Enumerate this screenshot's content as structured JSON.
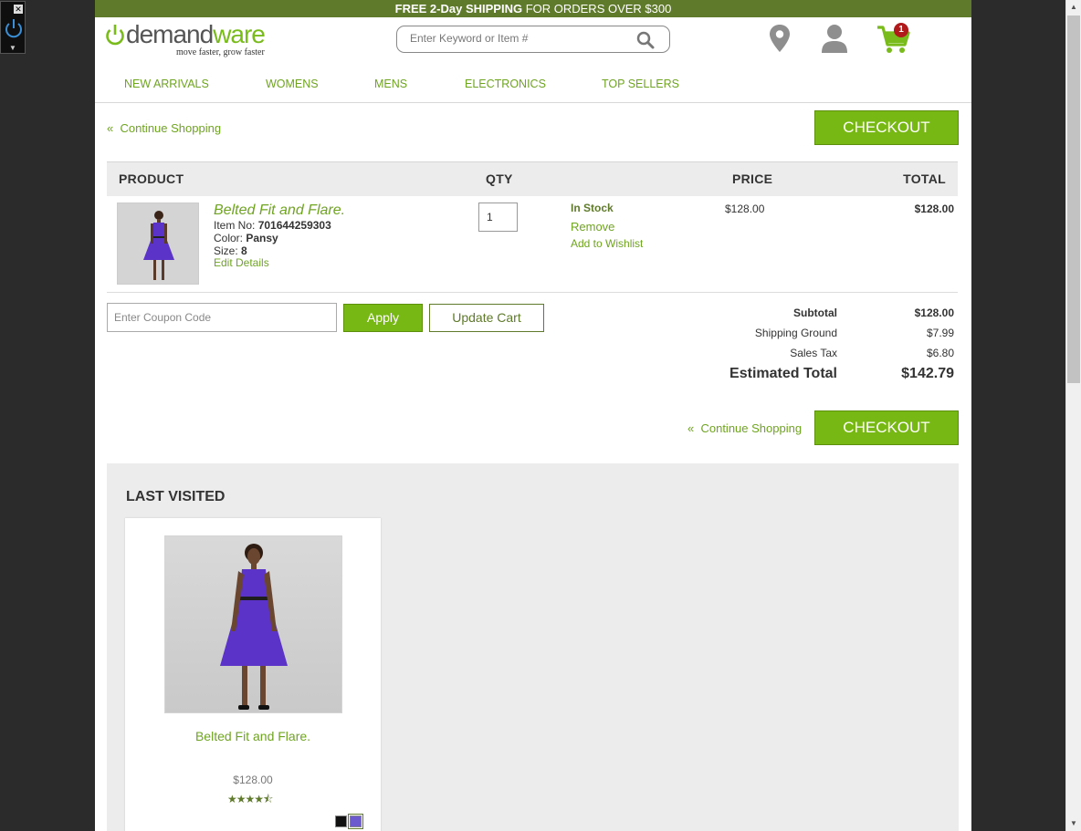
{
  "promo": {
    "bold1": "FREE 2-Day ",
    "bold2": "SHIPPING",
    "rest": " FOR ORDERS OVER $300"
  },
  "brand": {
    "logo_word_start": "demand",
    "logo_word_end": "ware",
    "tagline": "move faster, grow faster",
    "accent": "#78bb1a",
    "dark_green": "#5f7a2b"
  },
  "search": {
    "placeholder": "Enter Keyword or Item #"
  },
  "header_icons": [
    "map-pin-icon",
    "user-icon",
    "cart-icon"
  ],
  "cart": {
    "count": "1"
  },
  "nav": {
    "items": [
      "NEW ARRIVALS",
      "WOMENS",
      "MENS",
      "ELECTRONICS",
      "TOP SELLERS"
    ]
  },
  "actions": {
    "continue_shopping": "Continue Shopping",
    "checkout": "CHECKOUT",
    "apply": "Apply",
    "update_cart": "Update Cart",
    "coupon_placeholder": "Enter Coupon Code"
  },
  "table": {
    "headers": [
      "PRODUCT",
      "QTY",
      "PRICE",
      "TOTAL"
    ]
  },
  "item": {
    "name": "Belted Fit and Flare.",
    "item_no_label": "Item No: ",
    "item_no": "701644259303",
    "color_label": "Color: ",
    "color": "Pansy",
    "size_label": "Size: ",
    "size": "8",
    "edit": "Edit Details",
    "qty": "1",
    "stock": "In Stock",
    "remove": "Remove",
    "wishlist": "Add to Wishlist",
    "price": "$128.00",
    "total": "$128.00"
  },
  "summary": {
    "subtotal_label": "Subtotal",
    "subtotal": "$128.00",
    "shipping_label": "Shipping Ground",
    "shipping": "$7.99",
    "tax_label": "Sales Tax",
    "tax": "$6.80",
    "estimated_label": "Estimated Total",
    "estimated": "$142.79"
  },
  "last_visited": {
    "title": "LAST VISITED",
    "product_name": "Belted Fit and Flare.",
    "price": "$128.00",
    "rating": 4.5,
    "stars": "★★★★⯪",
    "swatches": [
      "#111111",
      "#6a5acd"
    ]
  }
}
